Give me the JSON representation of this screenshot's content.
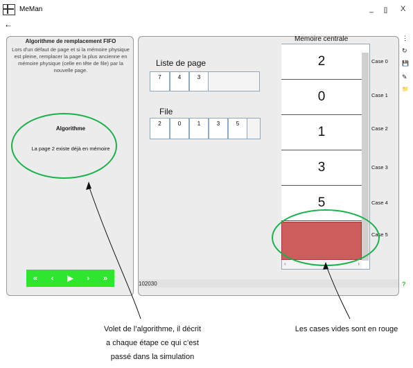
{
  "app": {
    "title": "MeMan",
    "minimize": "_",
    "maximize": "[]",
    "close": "X",
    "back": "←"
  },
  "algo_panel": {
    "title": "Algorithme de remplacement FIFO",
    "description": "Lors d'un défaut de page et si la mémoire physique est pleine, remplacer la page la plus ancienne en mémoire physique (celle en tête de file) par la nouvelle page.",
    "heading": "Algorithme",
    "message": "La page 2 existe déjà en mémoire",
    "controls": [
      "«",
      "‹",
      "▶",
      "›",
      "»"
    ]
  },
  "simulation": {
    "page_list_label": "Liste de page",
    "page_list": [
      "7",
      "4",
      "3"
    ],
    "queue_label": "File",
    "queue": [
      "2",
      "0",
      "1",
      "3",
      "5"
    ],
    "memory_title": "Memoire centrale",
    "cases": [
      {
        "label": "Case 0",
        "value": "2"
      },
      {
        "label": "Case 1",
        "value": "0"
      },
      {
        "label": "Case 2",
        "value": "1"
      },
      {
        "label": "Case 3",
        "value": "3"
      },
      {
        "label": "Case 4",
        "value": "5"
      },
      {
        "label": "Case 5",
        "value": ""
      }
    ],
    "footer_code": "102030",
    "scroll_left": "‹",
    "scroll_right": "›",
    "empty_color": "#cd5c5c"
  },
  "sidebar_icons": [
    "⋮",
    "↻",
    "💾",
    "✎",
    "📁",
    "?"
  ],
  "annotations": {
    "left": [
      "Volet de l’algorithme,  il décrit",
      "a chaque étape ce qui c’est",
      "passé dans la simulation"
    ],
    "right": "Les cases vides sont en rouge"
  }
}
